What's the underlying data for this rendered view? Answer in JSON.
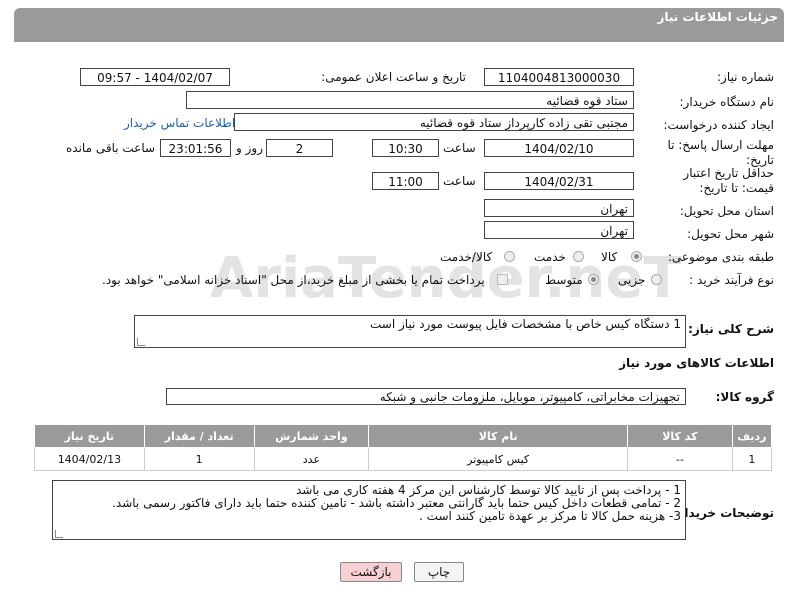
{
  "header": {
    "title": "جزئیات اطلاعات نیاز"
  },
  "fields": {
    "need_number": {
      "label": "شماره نیاز:",
      "value": "1104004813000030"
    },
    "announce_datetime": {
      "label": "تاریخ و ساعت اعلان عمومی:",
      "value": "1404/02/07 - 09:57"
    },
    "buyer_org": {
      "label": "نام دستگاه خریدار:",
      "value": "ستاد قوه قضائیه"
    },
    "requester": {
      "label": "ایجاد کننده درخواست:",
      "value": "مجتبی تقی زاده کارپرداز ستاد قوه قضائیه",
      "contact_link": "اطلاعات تماس خریدار"
    },
    "reply_deadline": {
      "label": "مهلت ارسال پاسخ: تا تاریخ:",
      "date": "1404/02/10",
      "time_label": "ساعت",
      "time": "10:30",
      "days": "2",
      "days_label": "روز و",
      "remaining": "23:01:56",
      "remaining_label": "ساعت باقی مانده"
    },
    "price_validity": {
      "label": "حداقل تاریخ اعتبار قیمت: تا تاریخ:",
      "date": "1404/02/31",
      "time_label": "ساعت",
      "time": "11:00"
    },
    "delivery_province": {
      "label": "استان محل تحویل:",
      "value": "تهران"
    },
    "delivery_city": {
      "label": "شهر محل تحویل:",
      "value": "تهران"
    },
    "category": {
      "label": "طبقه بندی موضوعی:",
      "options": [
        "کالا",
        "خدمت",
        "کالا/خدمت"
      ],
      "selected": "کالا"
    },
    "purchase_process": {
      "label": "نوع فرآیند خرید :",
      "options": [
        "جزیی",
        "متوسط"
      ],
      "selected": "متوسط",
      "note": "پرداخت تمام یا بخشی از مبلغ خرید،از محل \"اسناد خزانه اسلامی\" خواهد بود."
    }
  },
  "general_description": {
    "label": "شرح کلی نیاز:",
    "value": "1 دستگاه کیس خاص با مشخصات فایل پیوست مورد نیاز است"
  },
  "goods_section": {
    "title": "اطلاعات کالاهای مورد نیاز",
    "group_label": "گروه کالا:",
    "group_value": "تجهیزات مخابراتی، کامپیوتر، موبایل، ملزومات جانبی و شبکه"
  },
  "items_table": {
    "headers": [
      "ردیف",
      "کد کالا",
      "نام کالا",
      "واحد شمارش",
      "تعداد / مقدار",
      "تاریخ نیاز"
    ],
    "rows": [
      {
        "row": "1",
        "code": "--",
        "name": "کیس کامپیوتر",
        "unit": "عدد",
        "qty": "1",
        "date": "1404/02/13"
      }
    ]
  },
  "buyer_notes": {
    "label": "توضیحات خریدار:",
    "lines": [
      "1 - پرداخت پس از تایید کالا توسط کارشناس این مرکز 4 هفته کاری می باشد",
      "2 - تمامی قطعات داخل کیس حتما باید گارانتی معتبر داشته باشد - تامین کننده حتما باید دارای فاکتور رسمی باشد.",
      "3- هزینه حمل کالا تا مرکز بر عهدة تامین کنند است ."
    ]
  },
  "buttons": {
    "print": "چاپ",
    "back": "بازگشت"
  },
  "watermark": "AriaTender.neT",
  "colors": {
    "header": "#9a9a9a",
    "link": "#1a5fb4",
    "back_button": "#f8d0d4"
  }
}
